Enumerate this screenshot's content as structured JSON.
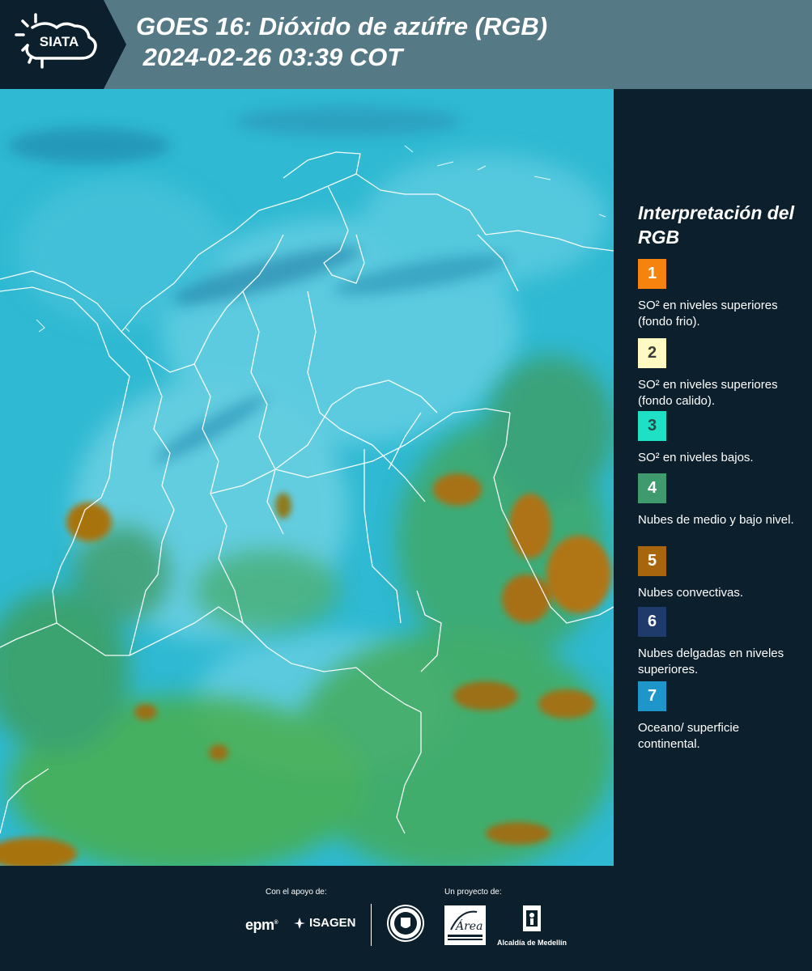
{
  "header": {
    "logo_text": "SIATA",
    "title": "GOES 16: Dióxido de azúfre (RGB)\n 2024-02-26 03:39 COT"
  },
  "legend": {
    "title": "Interpretación del RGB",
    "items": [
      {
        "number": "1",
        "text": "SO² en niveles superiores (fondo frio).",
        "color": "#f5830e",
        "number_color": "#ffffff"
      },
      {
        "number": "2",
        "text": "SO² en niveles superiores (fondo calido).",
        "color": "#fff9c2",
        "number_color": "#3a3a3a"
      },
      {
        "number": "3",
        "text": "SO² en niveles bajos.",
        "color": "#1de0c4",
        "number_color": "#2b4a4a"
      },
      {
        "number": "4",
        "text": "Nubes de medio y bajo nivel.",
        "color": "#3f9a6e",
        "number_color": "#ffffff"
      },
      {
        "number": "5",
        "text": "Nubes convectivas.",
        "color": "#a7650d",
        "number_color": "#ffffff"
      },
      {
        "number": "6",
        "text": "Nubes delgadas en niveles superiores.",
        "color": "#1f3b6c",
        "number_color": "#ffffff"
      },
      {
        "number": "7",
        "text": "Oceano/ superficie continental.",
        "color": "#1f96c9",
        "number_color": "#ffffff"
      }
    ]
  },
  "footer": {
    "support_label": "Con el apoyo de:",
    "project_label": "Un proyecto de:",
    "epm": "epm",
    "isagen": "ISAGEN",
    "area": "Área",
    "alcaldia": "Alcaldía de Medellín"
  },
  "colors": {
    "background": "#0c1f2c",
    "header": "#567a85",
    "map_base": "#2fb9d2",
    "land_green": "#46a85a",
    "convective_brown": "#a7730f"
  }
}
